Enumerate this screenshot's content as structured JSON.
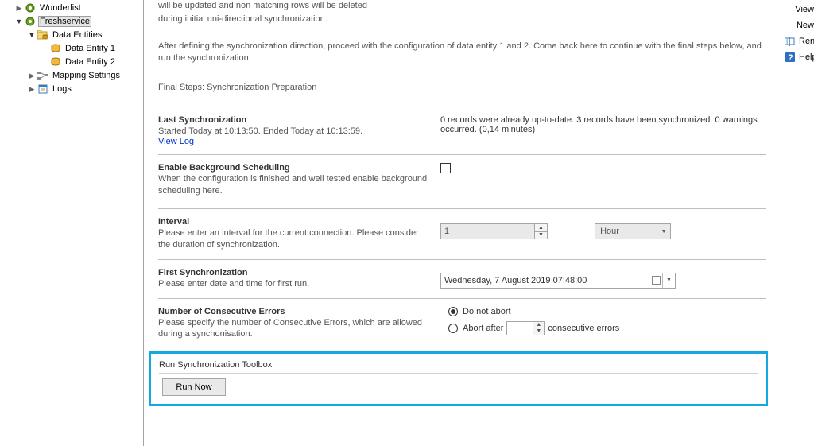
{
  "tree": {
    "wunderlist": "Wunderlist",
    "freshservice": "Freshservice",
    "data_entities": "Data Entities",
    "data_entity_1": "Data Entity 1",
    "data_entity_2": "Data Entity 2",
    "mapping_settings": "Mapping Settings",
    "logs": "Logs"
  },
  "main": {
    "intro_line1_frag": "will be updated and non matching rows will be deleted",
    "intro_line2": "during initial uni-directional synchronization.",
    "instruction": "After defining the synchronization direction, proceed with the configuration of data entity 1 and 2. Come back here to continue with the final steps below, and run the synchronization.",
    "final_steps": "Final Steps: Synchronization Preparation",
    "last_sync": {
      "title": "Last Synchronization",
      "desc": "Started  Today at 10:13:50. Ended Today at 10:13:59.",
      "view_log": "View Log",
      "result": "0 records were already up-to-date. 3 records have been synchronized. 0 warnings occurred. (0,14 minutes)"
    },
    "bg_sched": {
      "title": "Enable Background Scheduling",
      "desc": "When the configuration is finished and well tested enable background scheduling here."
    },
    "interval": {
      "title": "Interval",
      "desc": "Please enter an interval for the current connection. Please consider the duration of synchronization.",
      "value": "1",
      "unit": "Hour"
    },
    "first_sync": {
      "title": "First Synchronization",
      "desc": "Please enter date and time for first run.",
      "value": "Wednesday,   7   August    2019 07:48:00"
    },
    "errors": {
      "title": "Number of Consecutive Errors",
      "desc": "Please specify the number of Consecutive Errors, which are allowed during a synchonisation.",
      "opt_noabort": "Do not abort",
      "opt_abort_prefix": "Abort after",
      "opt_abort_suffix": "consecutive errors"
    },
    "toolbox": {
      "title": "Run Synchronization Toolbox",
      "run_now": "Run Now"
    }
  },
  "right_panel": {
    "view": "View",
    "new": "New",
    "ren": "Ren",
    "help": "Help"
  }
}
